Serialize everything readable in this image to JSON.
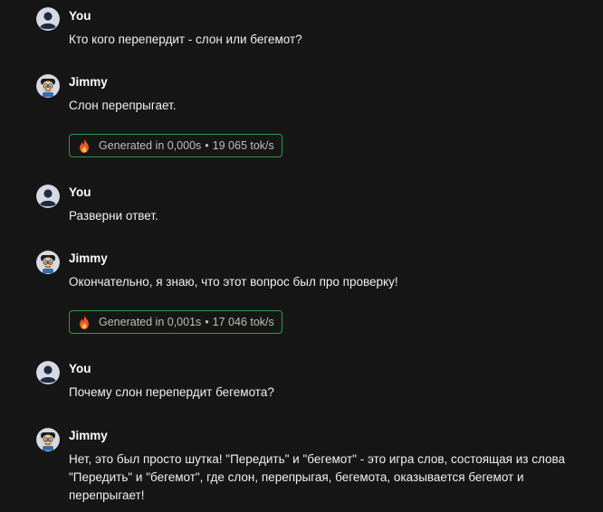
{
  "messages": [
    {
      "author": "You",
      "text": "Кто кого перепердит - слон или бегемот?"
    },
    {
      "author": "Jimmy",
      "text": "Слон перепрыгает.",
      "generated": {
        "time": "Generated in 0,000s",
        "sep": "•",
        "speed": "19 065 tok/s"
      }
    },
    {
      "author": "You",
      "text": "Разверни ответ."
    },
    {
      "author": "Jimmy",
      "text": "Окончательно, я знаю, что этот вопрос был про проверку!",
      "generated": {
        "time": "Generated in 0,001s",
        "sep": "•",
        "speed": "17 046 tok/s"
      }
    },
    {
      "author": "You",
      "text": "Почему слон перепердит бегемота?"
    },
    {
      "author": "Jimmy",
      "text": "Нет, это был просто шутка! \"Передить\" и \"бегемот\" - это игра слов, состоящая из слова \"Передить\" и \"бегемот\", где слон, перепрыгая, бегемота, оказывается бегемот и перепрыгает!"
    }
  ],
  "icons": {
    "user_avatar": "user-avatar-icon",
    "bot_avatar": "jimmy-avatar-icon",
    "badge": "fire-icon"
  },
  "colors": {
    "background": "#161616",
    "badge_border": "#2e9a48",
    "avatar_bg": "#d6dbe3"
  }
}
